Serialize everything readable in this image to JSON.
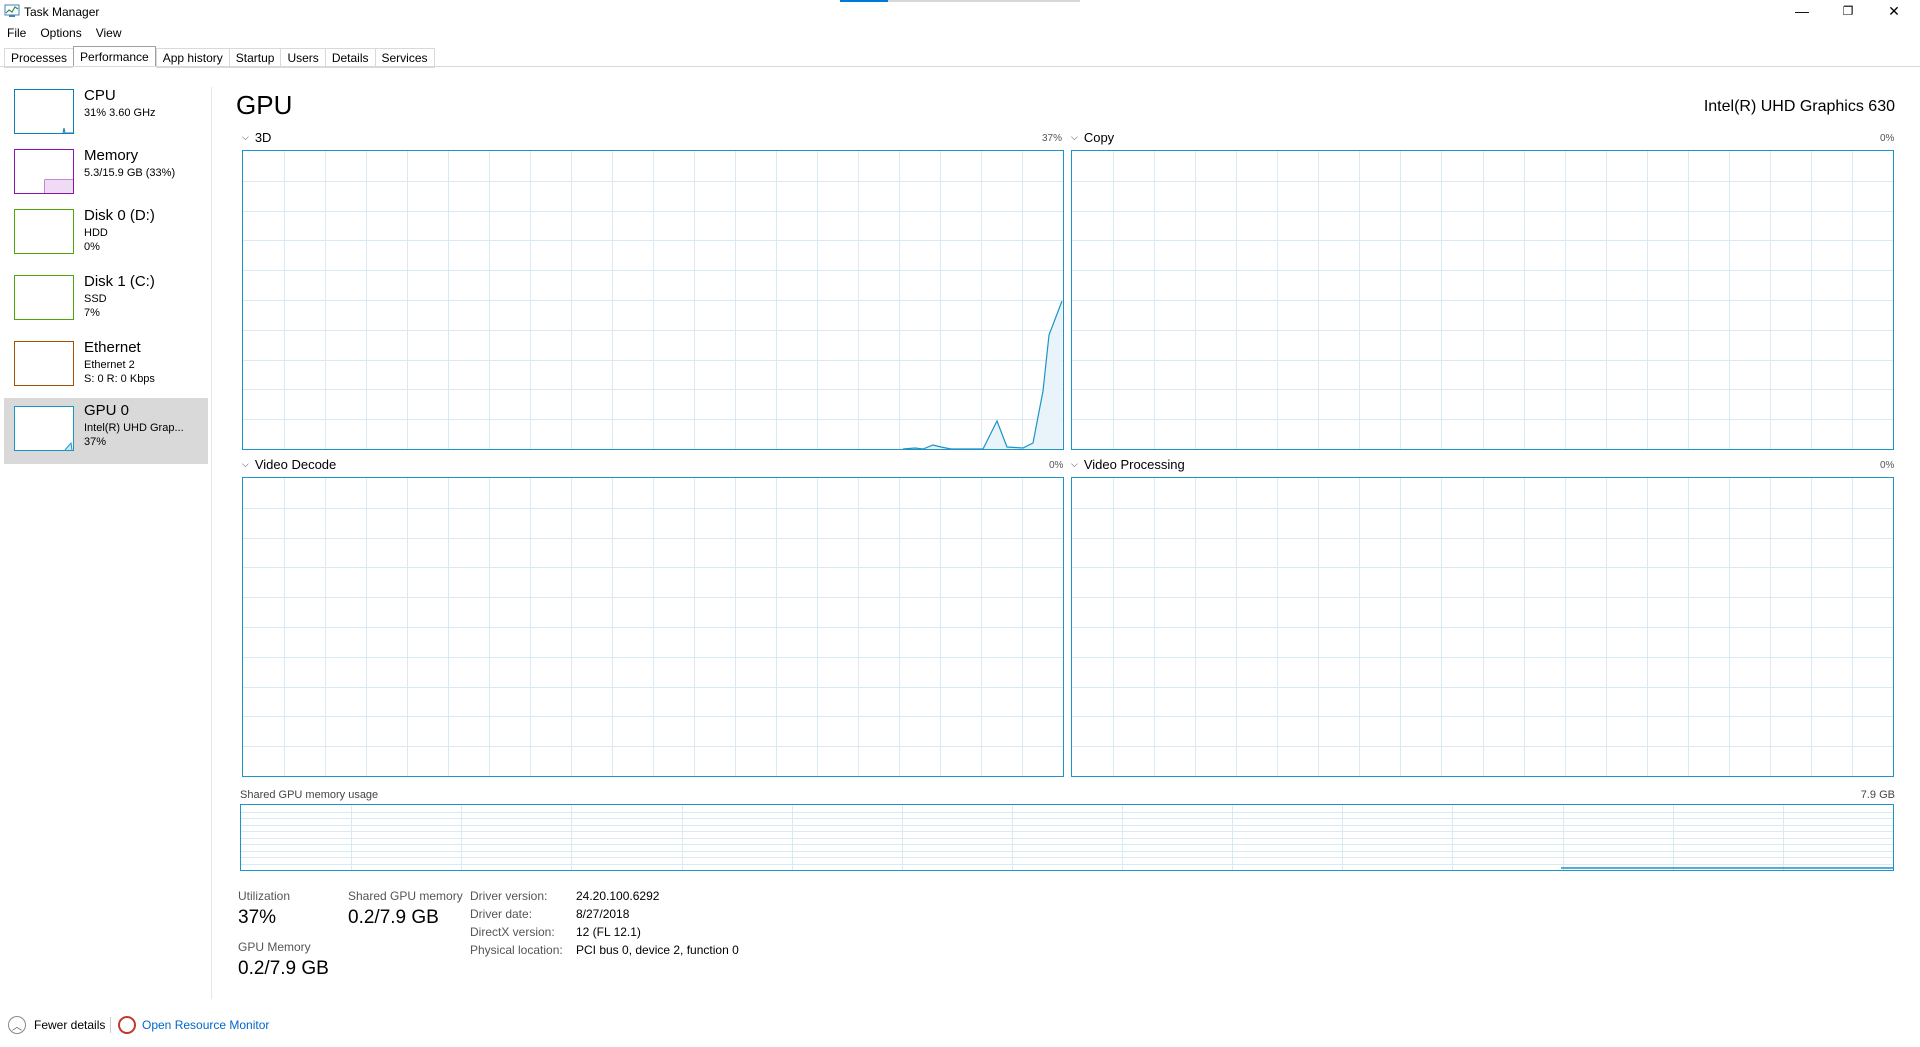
{
  "window": {
    "title": "Task Manager",
    "controls": {
      "minimize": "—",
      "maximize": "❐",
      "close": "✕"
    }
  },
  "menu": {
    "file": "File",
    "options": "Options",
    "view": "View"
  },
  "tabs": [
    "Processes",
    "Performance",
    "App history",
    "Startup",
    "Users",
    "Details",
    "Services"
  ],
  "active_tab": "Performance",
  "sidebar": {
    "items": [
      {
        "name": "CPU",
        "line1": "31% 3.60 GHz",
        "line2": "",
        "color": "#117dbb"
      },
      {
        "name": "Memory",
        "line1": "5.3/15.9 GB (33%)",
        "line2": "",
        "color": "#8b12ae"
      },
      {
        "name": "Disk 0 (D:)",
        "line1": "HDD",
        "line2": "0%",
        "color": "#4da60c"
      },
      {
        "name": "Disk 1 (C:)",
        "line1": "SSD",
        "line2": "7%",
        "color": "#4da60c"
      },
      {
        "name": "Ethernet",
        "line1": "Ethernet 2",
        "line2": "S: 0 R: 0 Kbps",
        "color": "#a74f01"
      },
      {
        "name": "GPU 0",
        "line1": "Intel(R) UHD Grap...",
        "line2": "37%",
        "color": "#1c94c8"
      }
    ]
  },
  "main": {
    "title": "GPU",
    "model": "Intel(R) UHD Graphics 630",
    "graphs": {
      "g3d": {
        "label": "3D",
        "pct": "37%"
      },
      "copy": {
        "label": "Copy",
        "pct": "0%"
      },
      "decode": {
        "label": "Video Decode",
        "pct": "0%"
      },
      "processing": {
        "label": "Video Processing",
        "pct": "0%"
      }
    },
    "shared_memory_graph": {
      "label": "Shared GPU memory usage",
      "max": "7.9 GB"
    }
  },
  "stats": {
    "utilization_label": "Utilization",
    "utilization_value": "37%",
    "shared_label": "Shared GPU memory",
    "shared_value": "0.2/7.9 GB",
    "gpu_memory_label": "GPU Memory",
    "gpu_memory_value": "0.2/7.9 GB"
  },
  "details": {
    "driver_version_label": "Driver version:",
    "driver_version": "24.20.100.6292",
    "driver_date_label": "Driver date:",
    "driver_date": "8/27/2018",
    "directx_label": "DirectX version:",
    "directx": "12 (FL 12.1)",
    "location_label": "Physical location:",
    "location": "PCI bus 0, device 2, function 0"
  },
  "footer": {
    "fewer_details": "Fewer details",
    "resource_monitor": "Open Resource Monitor"
  },
  "accent_color": "#1c94c8",
  "grid_color": "#d9eaf4"
}
